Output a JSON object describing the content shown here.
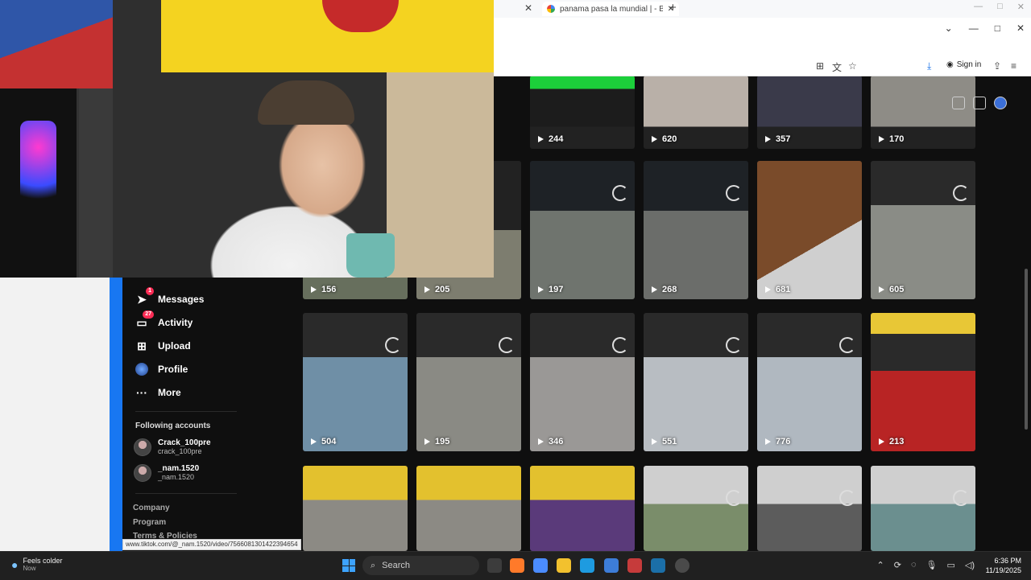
{
  "browser": {
    "tab_title": "panama pasa la mundial | - Busca",
    "tab_close": "✕",
    "prev_tab_close": "✕",
    "new_tab": "+",
    "sign_in": "Sign in",
    "status_url": "www.tiktok.com/@_nam.1520/video/7566081301422394654"
  },
  "sidebar": {
    "items": [
      {
        "label": "Messages",
        "icon": "send-icon",
        "badge": "1"
      },
      {
        "label": "Activity",
        "icon": "message-icon",
        "badge": "27"
      },
      {
        "label": "Upload",
        "icon": "plus-square-icon"
      },
      {
        "label": "Profile",
        "icon": "avatar-icon"
      },
      {
        "label": "More",
        "icon": "ellipsis-icon"
      }
    ],
    "following_heading": "Following accounts",
    "accounts": [
      {
        "name": "Crack_100pre",
        "handle": "crack_100pre"
      },
      {
        "name": "_nam.1520",
        "handle": "_nam.1520"
      }
    ],
    "footer": [
      "Company",
      "Program",
      "Terms & Policies"
    ]
  },
  "grid": {
    "rows": [
      [
        "244",
        "620",
        "357",
        "170"
      ],
      [
        "156",
        "205",
        "197",
        "268",
        "681",
        "605"
      ],
      [
        "504",
        "195",
        "346",
        "551",
        "776",
        "213"
      ]
    ]
  },
  "taskbar": {
    "weather_title": "Feels colder",
    "weather_sub": "Now",
    "search_placeholder": "Search",
    "time": "6:36 PM",
    "date": "11/19/2025"
  }
}
